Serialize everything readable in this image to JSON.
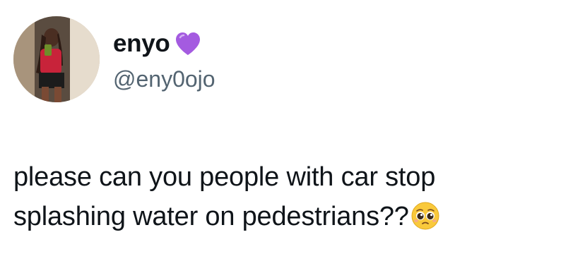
{
  "user": {
    "display_name": "enyo",
    "handle": "@eny0ojo",
    "avatar_icon": "profile-photo",
    "name_emoji": "purple-heart-icon"
  },
  "tweet": {
    "line1": "please can you people with car stop",
    "line2": "splashing water on pedestrians??",
    "trailing_emoji": "pleading-face-icon"
  },
  "colors": {
    "text_primary": "#0f1419",
    "text_secondary": "#536471",
    "heart": "#a45be0",
    "emoji_face": "#f9c93b"
  }
}
